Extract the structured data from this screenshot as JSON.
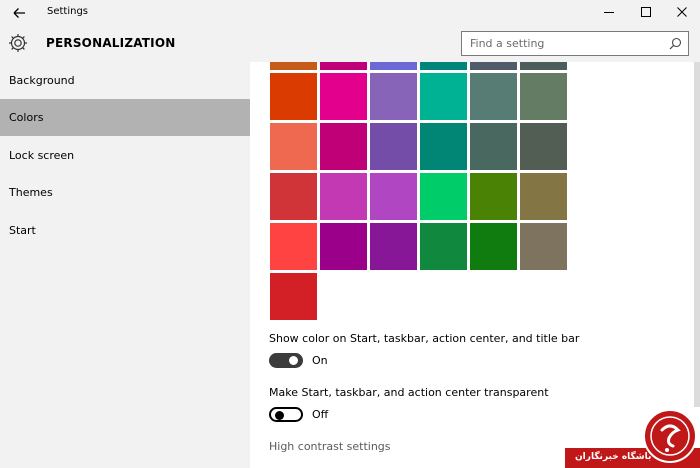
{
  "window": {
    "title": "Settings"
  },
  "header": {
    "section": "PERSONALIZATION",
    "search_placeholder": "Find a setting"
  },
  "sidebar": {
    "items": [
      {
        "label": "Background"
      },
      {
        "label": "Colors"
      },
      {
        "label": "Lock screen"
      },
      {
        "label": "Themes"
      },
      {
        "label": "Start"
      }
    ],
    "active_index": 1
  },
  "colors": {
    "partial_row": [
      "#c75b1a",
      "#c0007a",
      "#6b69d6",
      "#00857a",
      "#515c6b",
      "#4c5e5b"
    ],
    "rows": [
      [
        "#da3b01",
        "#e3008c",
        "#8764b8",
        "#00b294",
        "#567c73",
        "#647c64"
      ],
      [
        "#ef6950",
        "#bf0077",
        "#744da9",
        "#018574",
        "#486860",
        "#525e54"
      ],
      [
        "#d13438",
        "#c239b3",
        "#b146c2",
        "#00cc6a",
        "#498205",
        "#847545"
      ],
      [
        "#ff4343",
        "#9a0089",
        "#881798",
        "#10893e",
        "#107c10",
        "#7e735f"
      ],
      [
        "#d32027"
      ]
    ]
  },
  "options": {
    "show_color": {
      "label": "Show color on Start, taskbar, action center, and title bar",
      "state": "On"
    },
    "transparent": {
      "label": "Make Start, taskbar, and action center transparent",
      "state": "Off"
    }
  },
  "links": {
    "high_contrast": "High contrast settings"
  },
  "watermark": {
    "text": "باشگاه خبرنگاران"
  }
}
